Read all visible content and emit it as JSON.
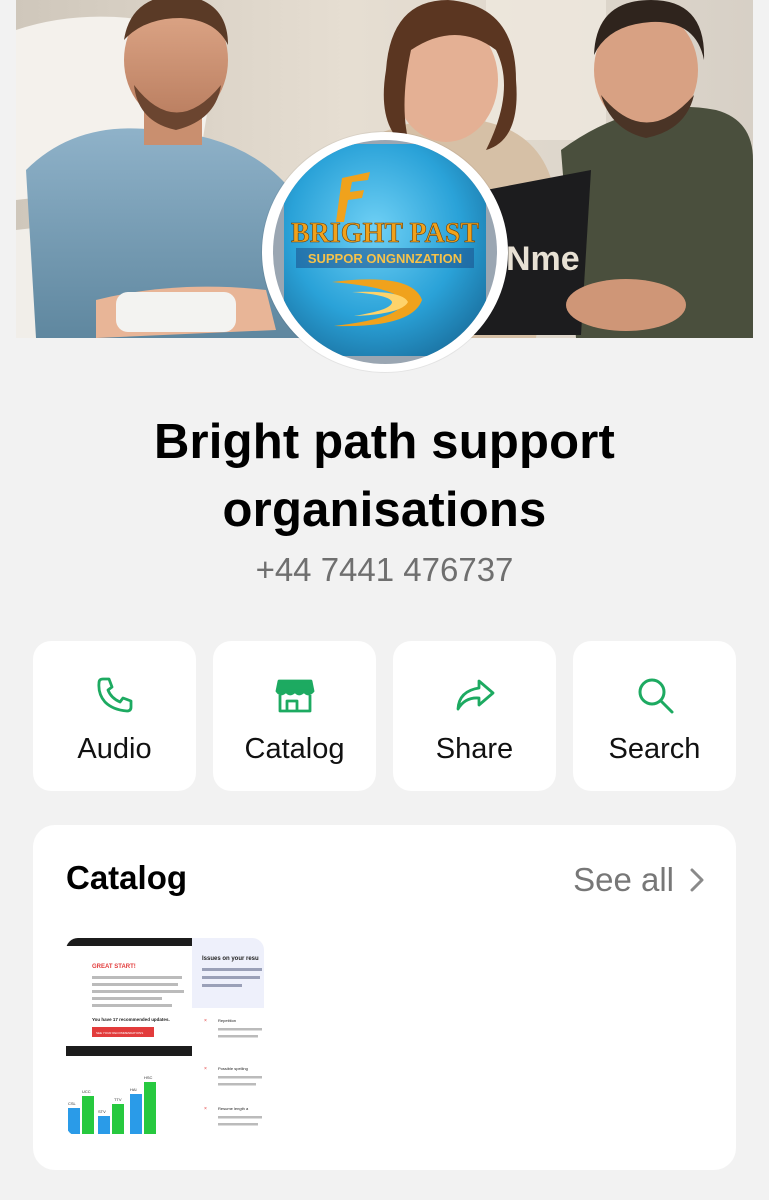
{
  "profile": {
    "business_name_line1": "Bright path support",
    "business_name_line2": "organisations",
    "phone": "+44 7441 476737",
    "logo_text_line1": "BRIGHT PAST",
    "logo_text_line2": "SUPPOR ONGNNZATION",
    "cover_laptop_text": "Nme"
  },
  "actions": [
    {
      "label": "Audio",
      "icon": "phone-icon"
    },
    {
      "label": "Catalog",
      "icon": "storefront-icon"
    },
    {
      "label": "Share",
      "icon": "share-arrow-icon"
    },
    {
      "label": "Search",
      "icon": "search-icon"
    }
  ],
  "catalog": {
    "title": "Catalog",
    "see_all_label": "See all",
    "item": {
      "heading_left": "GREAT START!",
      "heading_right": "Issues on your resu",
      "button_text": "SEE YOUR RECOMMENDATIONS",
      "updates_text": "You have 17 recommended updates.",
      "issue_1": "Repetition",
      "issue_2": "Possible spelling",
      "issue_3": "Resume length a"
    }
  },
  "colors": {
    "accent_green": "#1daa61",
    "page_background": "#f2f2f2",
    "logo_blue": "#2aa2d8",
    "logo_gold": "#f0a21c"
  }
}
